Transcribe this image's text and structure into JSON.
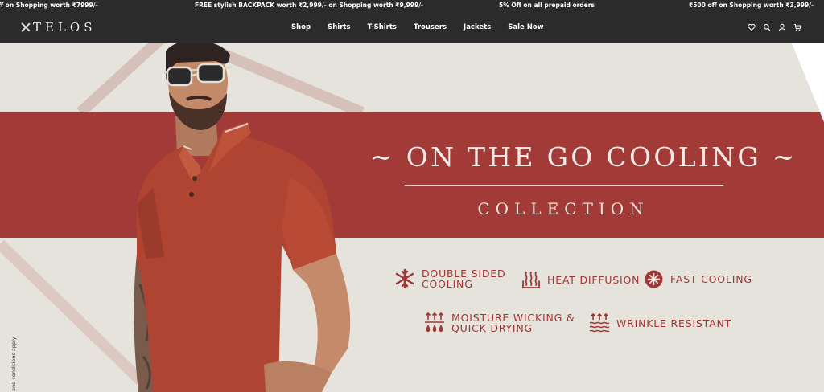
{
  "ticker": [
    "ff on Shopping worth ₹7999/-",
    "FREE stylish BACKPACK worth ₹2,999/- on Shopping worth ₹9,999/-",
    "5% Off on all prepaid orders",
    "₹500 off on Shopping worth ₹3,999/-"
  ],
  "brand": {
    "name": "TELOS"
  },
  "nav": [
    "Shop",
    "Shirts",
    "T-Shirts",
    "Trousers",
    "Jackets",
    "Sale Now"
  ],
  "icons": [
    "heart-icon",
    "search-icon",
    "user-icon",
    "cart-icon"
  ],
  "hero": {
    "title": "~ ON THE GO COOLING ~",
    "subtitle": "COLLECTION",
    "features": [
      {
        "label": "DOUBLE SIDED\nCOOLING",
        "icon": "snowflake-icon"
      },
      {
        "label": "HEAT DIFFUSION",
        "icon": "heat-icon"
      },
      {
        "label": "FAST COOLING",
        "icon": "fan-icon"
      },
      {
        "label": "MOISTURE WICKING &\nQUICK DRYING",
        "icon": "droplets-icon"
      },
      {
        "label": "WRINKLE RESISTANT",
        "icon": "waves-icon"
      }
    ],
    "terms": "and conditions apply"
  },
  "colors": {
    "band": "#a23a37",
    "accent": "#a03735",
    "topbar": "#2b2b2b",
    "background": "#e6e2dc"
  }
}
